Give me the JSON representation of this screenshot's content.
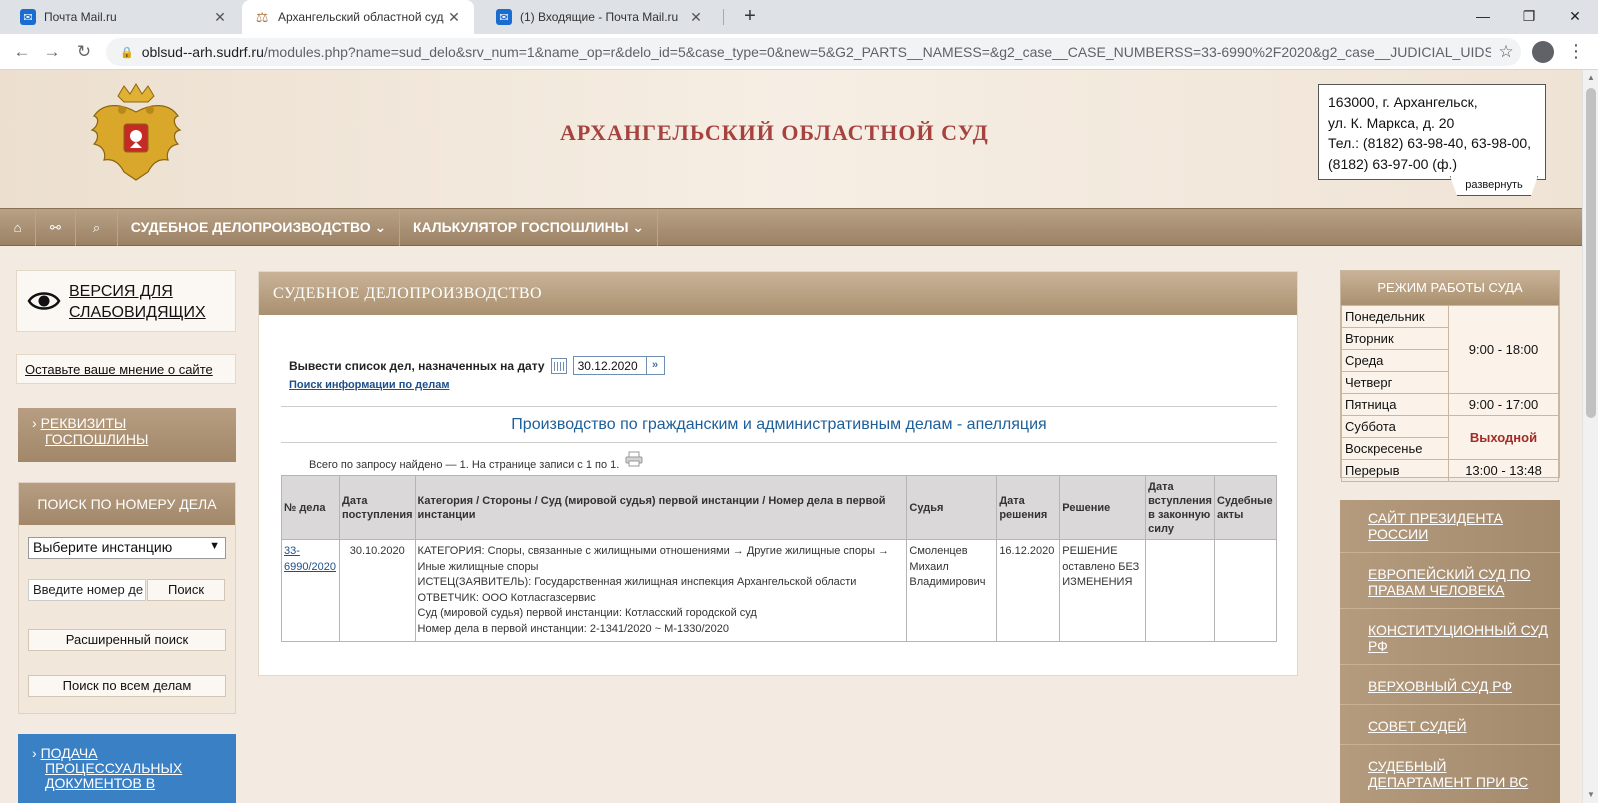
{
  "browser": {
    "tabs": [
      {
        "title": "Почта Mail.ru",
        "icon": "mail-icon"
      },
      {
        "title": "Архангельский областной суд",
        "icon": "scales-icon"
      },
      {
        "title": "(1) Входящие - Почта Mail.ru",
        "icon": "mail-icon"
      }
    ],
    "url_host": "oblsud--arh.sudrf.ru",
    "url_path": "/modules.php?name=sud_delo&srv_num=1&name_op=r&delo_id=5&case_type=0&new=5&G2_PARTS__NAMESS=&g2_case__CASE_NUMBERSS=33-6990%2F2020&g2_case__JUDICIAL_UIDSS=&..."
  },
  "header": {
    "court_title": "АРХАНГЕЛЬСКИЙ ОБЛАСТНОЙ СУД",
    "address_lines": [
      "163000, г. Архангельск,",
      "ул. К. Маркса, д. 20",
      "Тел.: (8182) 63-98-40, 63-98-00,",
      "(8182) 63-97-00 (ф.)"
    ],
    "expand_label": "развернуть"
  },
  "nav": {
    "home_icon": "⌂",
    "sitemap_icon": "⚯",
    "search_icon": "⌕",
    "items": [
      "СУДЕБНОЕ ДЕЛОПРОИЗВОДСТВО ⌄",
      "КАЛЬКУЛЯТОР ГОСПОШЛИНЫ ⌄"
    ]
  },
  "left": {
    "lowvision_line1": "ВЕРСИЯ ДЛЯ",
    "lowvision_line2": "СЛАБОВИДЯЩИХ",
    "feedback": "Оставьте ваше мнение о сайте",
    "rekv_line1": "РЕКВИЗИТЫ",
    "rekv_line2": "ГОСПОШЛИНЫ",
    "search_title": "ПОИСК ПО НОМЕРУ ДЕЛА",
    "instance_select": "Выберите инстанцию",
    "number_placeholder": "Введите номер де",
    "search_button": "Поиск",
    "advanced_search": "Расширенный поиск",
    "all_cases_search": "Поиск по всем делам",
    "podacha_lines": [
      "ПОДАЧА",
      "ПРОЦЕССУАЛЬНЫХ",
      "ДОКУМЕНТОВ В"
    ]
  },
  "main": {
    "heading": "СУДЕБНОЕ ДЕЛОПРОИЗВОДСТВО",
    "date_label": "Вывести список дел, назначенных на дату",
    "date_value": "30.12.2020",
    "search_link": "Поиск информации по делам",
    "section_title": "Производство по гражданским и административным делам - апелляция",
    "found_text": "Всего по запросу найдено — 1. На странице записи с 1 по 1.",
    "columns": [
      "№ дела",
      "Дата поступления",
      "Категория / Стороны / Суд (мировой судья) первой инстанции / Номер дела в первой инстанции",
      "Судья",
      "Дата решения",
      "Решение",
      "Дата вступления в законную силу",
      "Судебные акты"
    ],
    "row": {
      "number": "33-6990/2020",
      "received": "30.10.2020",
      "details": [
        "КАТЕГОРИЯ: Споры, связанные с жилищными отношениями → Другие жилищные споры → Иные жилищные споры",
        "ИСТЕЦ(ЗАЯВИТЕЛЬ): Государственная жилищная инспекция Архангельской области",
        "ОТВЕТЧИК: ООО Котласгазсервис",
        "Суд (мировой судья) первой инстанции: Котласский городской суд",
        "Номер дела в первой инстанции: 2-1341/2020 ~ М-1330/2020"
      ],
      "judge": "Смоленцев Михаил Владимирович",
      "decision_date": "16.12.2020",
      "decision": "РЕШЕНИЕ оставлено БЕЗ ИЗМЕНЕНИЯ",
      "effective_date": "",
      "acts": ""
    }
  },
  "right": {
    "hours_title": "РЕЖИМ РАБОТЫ СУДА",
    "days": [
      "Понедельник",
      "Вторник",
      "Среда",
      "Четверг",
      "Пятница",
      "Суббота",
      "Воскресенье",
      "Перерыв"
    ],
    "weekday_hours": "9:00 - 18:00",
    "friday_hours": "9:00 - 17:00",
    "weekend": "Выходной",
    "break_hours": "13:00 - 13:48",
    "links": [
      "САЙТ ПРЕЗИДЕНТА РОССИИ",
      "ЕВРОПЕЙСКИЙ СУД ПО ПРАВАМ ЧЕЛОВЕКА",
      "КОНСТИТУЦИОННЫЙ СУД РФ",
      "ВЕРХОВНЫЙ СУД РФ",
      "СОВЕТ СУДЕЙ",
      "СУДЕБНЫЙ ДЕПАРТАМЕНТ ПРИ ВС"
    ]
  }
}
